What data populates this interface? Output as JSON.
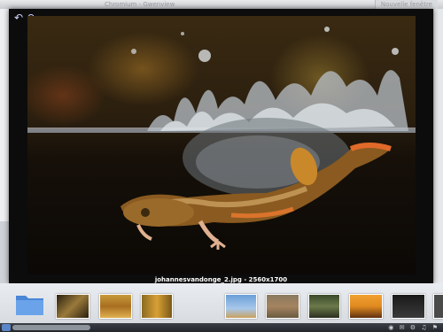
{
  "background_window": {
    "title": "Chromium - Gwenview",
    "right_tab": "Nouvelle fenêtre"
  },
  "viewer": {
    "rotate_left_icon": "↶",
    "rotate_right_icon": "↷",
    "caption": "johannesvandonge_2.jpg - 2560x1700"
  },
  "thumbnails": [
    {
      "name": "folder",
      "color": "#4a86d6"
    },
    {
      "name": "thumb-frog",
      "color": "#8a6a2a"
    },
    {
      "name": "thumb-grass",
      "color": "#c79a3a"
    },
    {
      "name": "thumb-wheat",
      "color": "#d8a035"
    },
    {
      "name": "thumb-giraffe",
      "color": "#6a9fd8"
    },
    {
      "name": "thumb-lion",
      "color": "#a58460"
    },
    {
      "name": "thumb-animals",
      "color": "#6c7a4a"
    },
    {
      "name": "thumb-sunset",
      "color": "#e08a20"
    },
    {
      "name": "thumb-elephant",
      "color": "#2a2a2a"
    },
    {
      "name": "thumb-dark",
      "color": "#4a4a4a"
    }
  ],
  "taskbar": {
    "tray_icons": "◉ ✉ ⚙ ♫ ⚑"
  }
}
